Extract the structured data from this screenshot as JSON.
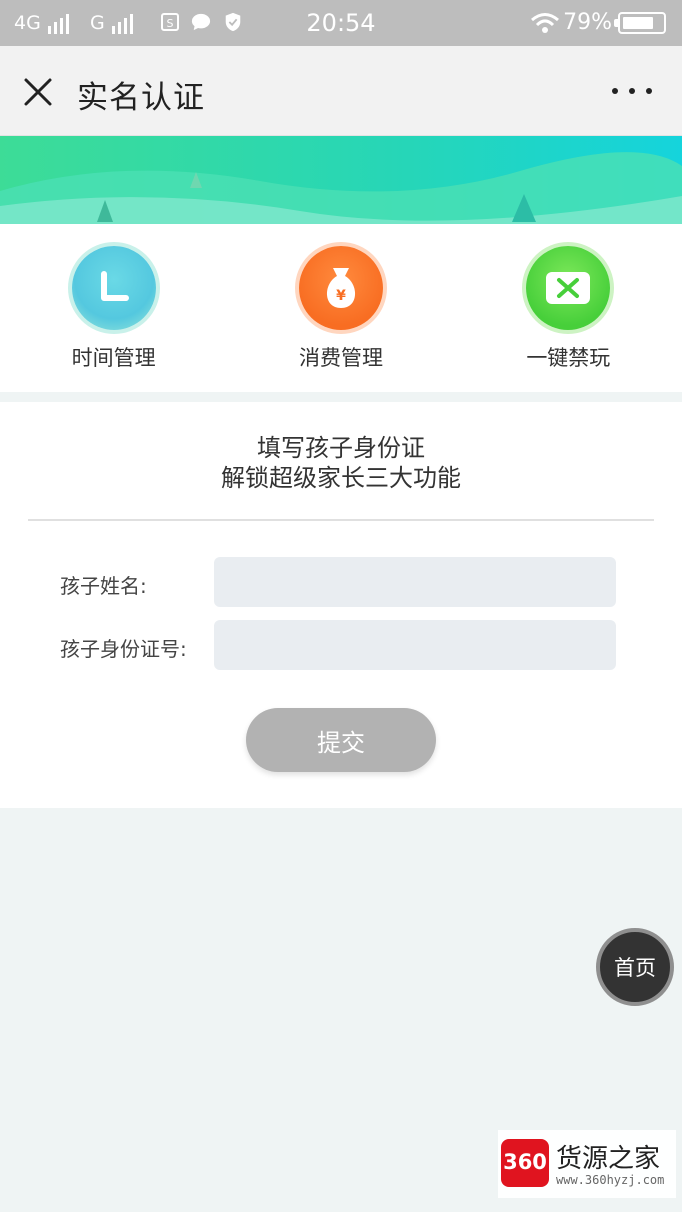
{
  "status_bar": {
    "network1": "4G",
    "network2": "G",
    "time": "20:54",
    "battery_percent": "79%",
    "battery_level": 0.79
  },
  "header": {
    "title": "实名认证",
    "close_icon": "close-icon",
    "more_icon": "more-icon"
  },
  "features": [
    {
      "label": "时间管理",
      "icon": "clock-icon",
      "color": "#54c8df"
    },
    {
      "label": "消费管理",
      "icon": "money-bag-icon",
      "color": "#f86d22"
    },
    {
      "label": "一键禁玩",
      "icon": "game-ban-icon",
      "color": "#47cf3a"
    }
  ],
  "form": {
    "intro_line1": "填写孩子身份证",
    "intro_line2": "解锁超级家长三大功能",
    "name_label": "孩子姓名:",
    "name_value": "",
    "id_label": "孩子身份证号:",
    "id_value": "",
    "submit_label": "提交"
  },
  "home_button": {
    "label": "首页"
  },
  "watermark": {
    "logo_text": "360",
    "title": "货源之家",
    "url": "www.360hyzj.com"
  },
  "colors": {
    "banner_start": "#3ddc97",
    "banner_end": "#15d4dc",
    "submit_disabled": "#b2b2b2",
    "page_bg": "#eff4f4"
  }
}
